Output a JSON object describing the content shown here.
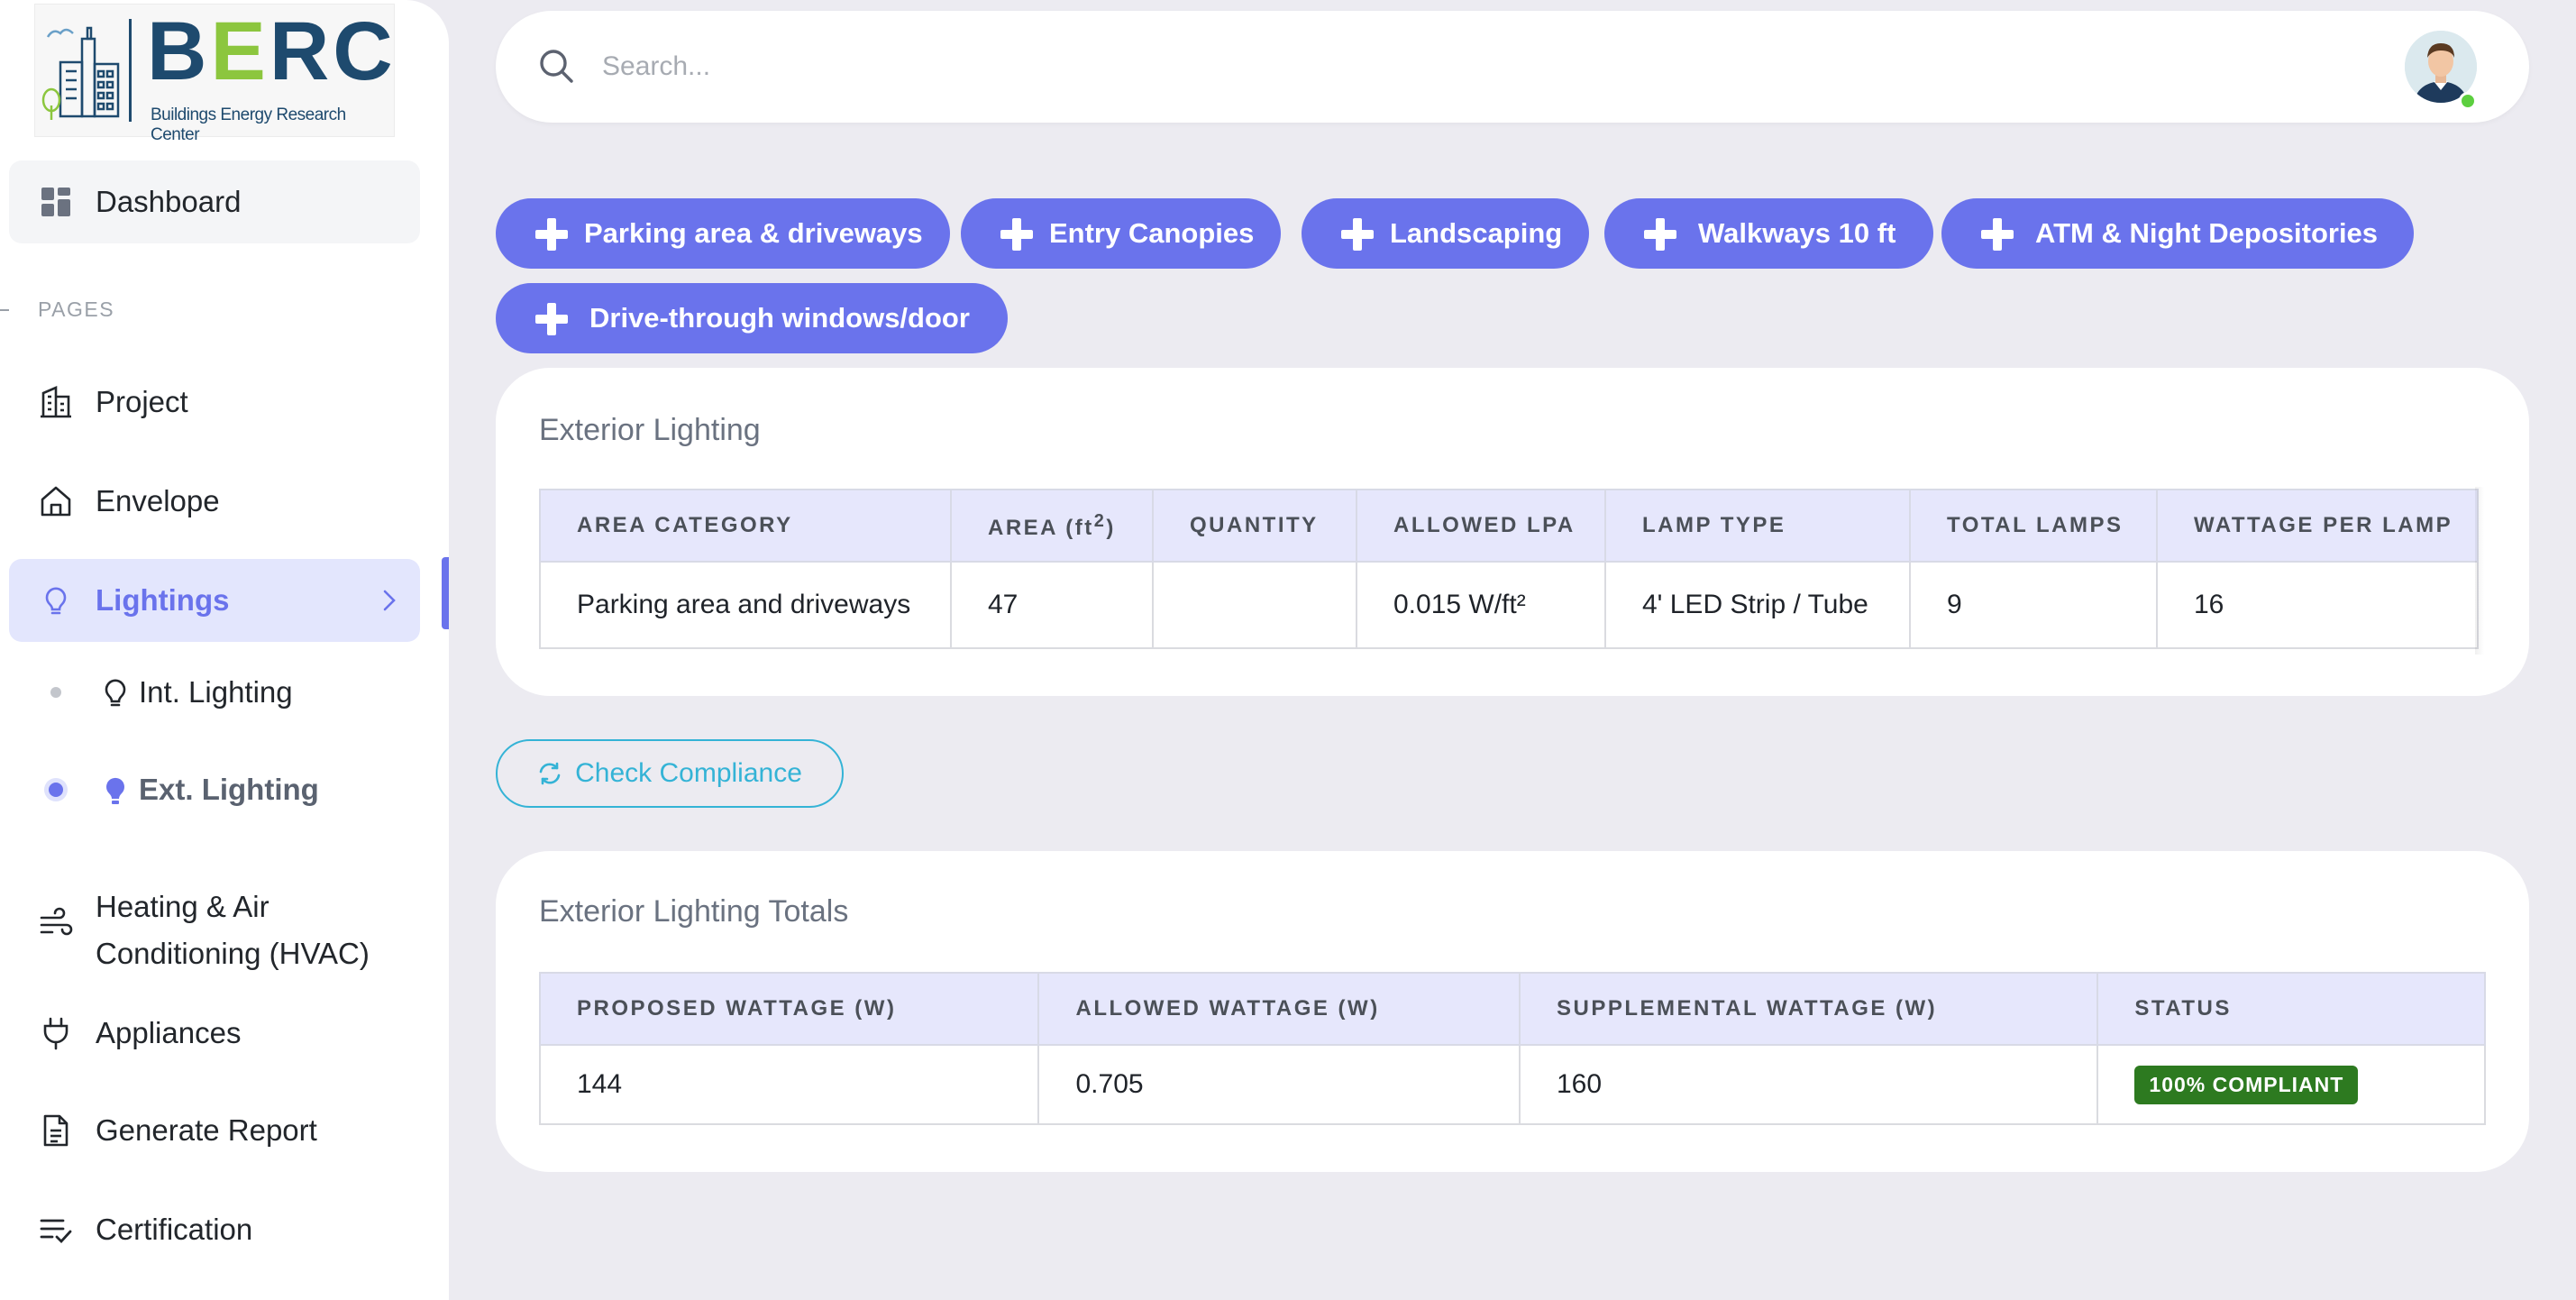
{
  "brand": {
    "logo_text": "BERC",
    "logo_subtitle": "Buildings Energy Research Center"
  },
  "sidebar": {
    "dashboard_label": "Dashboard",
    "pages_heading": "PAGES",
    "items": [
      {
        "label": "Project",
        "icon": "building-icon"
      },
      {
        "label": "Envelope",
        "icon": "home-icon"
      },
      {
        "label": "Lightings",
        "icon": "bulb-icon",
        "active": true
      },
      {
        "label": "Heating & Air Conditioning (HVAC)",
        "icon": "wind-icon"
      },
      {
        "label": "Appliances",
        "icon": "plug-icon"
      },
      {
        "label": "Generate Report",
        "icon": "document-icon"
      },
      {
        "label": "Certification",
        "icon": "list-check-icon"
      }
    ],
    "lighting_sub": [
      {
        "label": "Int. Lighting",
        "icon": "bulb-outline-icon"
      },
      {
        "label": "Ext. Lighting",
        "icon": "bulb-filled-icon",
        "active": true
      }
    ]
  },
  "search": {
    "placeholder": "Search..."
  },
  "chips": [
    "Parking area & driveways",
    "Entry Canopies",
    "Landscaping",
    "Walkways 10 ft",
    "ATM & Night Depositories",
    "Drive-through windows/door"
  ],
  "exterior_lighting": {
    "title": "Exterior Lighting",
    "columns": [
      "AREA CATEGORY",
      "AREA (ft2)",
      "QUANTITY",
      "ALLOWED LPA",
      "LAMP TYPE",
      "TOTAL LAMPS",
      "WATTAGE PER LAMP"
    ],
    "rows": [
      [
        "Parking area and driveways",
        "47",
        "",
        "0.015 W/ft²",
        "4' LED Strip / Tube",
        "9",
        "16"
      ]
    ]
  },
  "check_button_label": "Check Compliance",
  "totals": {
    "title": "Exterior Lighting Totals",
    "columns": [
      "PROPOSED WATTAGE (W)",
      "ALLOWED WATTAGE (W)",
      "SUPPLEMENTAL WATTAGE (W)",
      "STATUS"
    ],
    "row": [
      "144",
      "0.705",
      "160"
    ],
    "status": "100% COMPLIANT"
  },
  "colors": {
    "accent": "#6a73ec",
    "check_button": "#34b3d6",
    "compliant_badge": "#2d7a20",
    "brand_navy": "#1e4a6e",
    "brand_green": "#8cc63e"
  }
}
